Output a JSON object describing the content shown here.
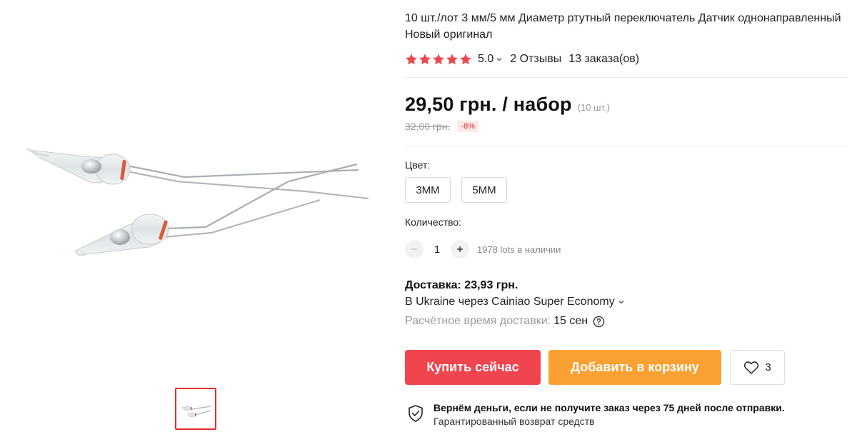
{
  "product": {
    "title": "10 шт./лот 3 мм/5 мм Диаметр ртутный переключатель Датчик однонаправленный Новый оригинал",
    "rating": {
      "stars": 5,
      "value": "5.0",
      "reviews": "2 Отзывы",
      "orders": "13 заказа(ов)"
    },
    "price": {
      "current": "29,50 грн. / набор",
      "unit_note": "(10 шт.)",
      "old": "32,00 грн.",
      "discount": "-8%"
    },
    "color": {
      "label": "Цвет:",
      "options": [
        "3MM",
        "5MM"
      ]
    },
    "quantity": {
      "label": "Количество:",
      "value": "1",
      "stock": "1978 lots в наличии"
    },
    "delivery": {
      "title": "Доставка: 23,93 грн.",
      "method": "В Ukraine через Cainiao Super Economy",
      "time_label": "Расчётное время доставки:",
      "time_value": "15 сен"
    },
    "actions": {
      "buy_label": "Купить сейчас",
      "cart_label": "Добавить в корзину",
      "wishlist_count": "3"
    },
    "guarantee": {
      "main": "Вернём деньги, если не получите заказ через 75 дней после отправки.",
      "sub": "Гарантированный возврат средств"
    }
  },
  "colors": {
    "star": "#f0454f",
    "buy_button": "#f0454f",
    "cart_button": "#fba032",
    "thumb_border": "#e52d2d",
    "discount_text": "#e52d2d"
  },
  "icons": [
    "star-icon",
    "chevron-down-icon",
    "minus-icon",
    "plus-icon",
    "help-icon",
    "heart-icon",
    "shield-check-icon"
  ]
}
